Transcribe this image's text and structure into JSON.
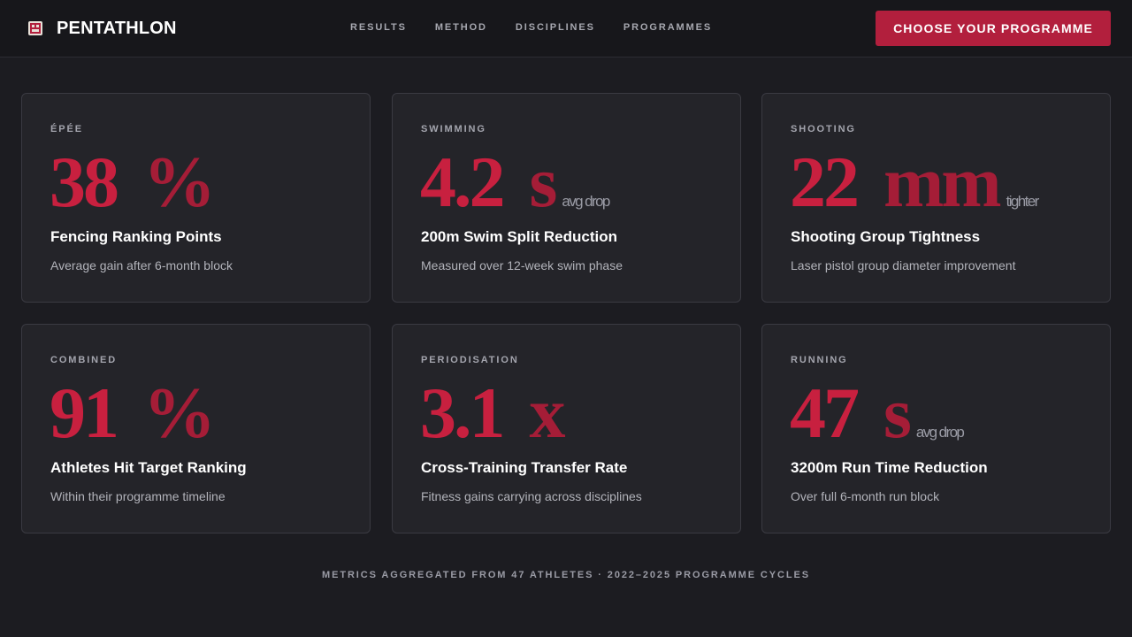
{
  "header": {
    "brand_name": "PENTATHLON",
    "brand_icon": "mask-badge-icon",
    "nav": [
      "RESULTS",
      "METHOD",
      "DISCIPLINES",
      "PROGRAMMES"
    ],
    "cta_label": "CHOOSE YOUR PROGRAMME"
  },
  "colors": {
    "accent": "#c8203f",
    "accent_dark": "#a51d37",
    "cta": "#b21f3d",
    "background": "#1c1c21",
    "card": "#242429"
  },
  "cards": [
    {
      "label": "ÉPÉE",
      "value": "38",
      "unit": "%",
      "note": "",
      "title": "Fencing Ranking Points",
      "desc": "Average gain after 6-month block"
    },
    {
      "label": "SWIMMING",
      "value": "4.2",
      "unit": "s",
      "note": "avg drop",
      "title": "200m Swim Split Reduction",
      "desc": "Measured over 12-week swim phase"
    },
    {
      "label": "SHOOTING",
      "value": "22",
      "unit": "mm",
      "note": "tighter",
      "title": "Shooting Group Tightness",
      "desc": "Laser pistol group diameter improvement"
    },
    {
      "label": "COMBINED",
      "value": "91",
      "unit": "%",
      "note": "",
      "title": "Athletes Hit Target Ranking",
      "desc": "Within their programme timeline"
    },
    {
      "label": "PERIODISATION",
      "value": "3.1",
      "unit": "x",
      "note": "",
      "title": "Cross-Training Transfer Rate",
      "desc": "Fitness gains carrying across disciplines"
    },
    {
      "label": "RUNNING",
      "value": "47",
      "unit": "s",
      "note": "avg drop",
      "title": "3200m Run Time Reduction",
      "desc": "Over full 6-month run block"
    }
  ],
  "footer": {
    "note": "METRICS AGGREGATED FROM 47 ATHLETES · 2022–2025 PROGRAMME CYCLES"
  }
}
